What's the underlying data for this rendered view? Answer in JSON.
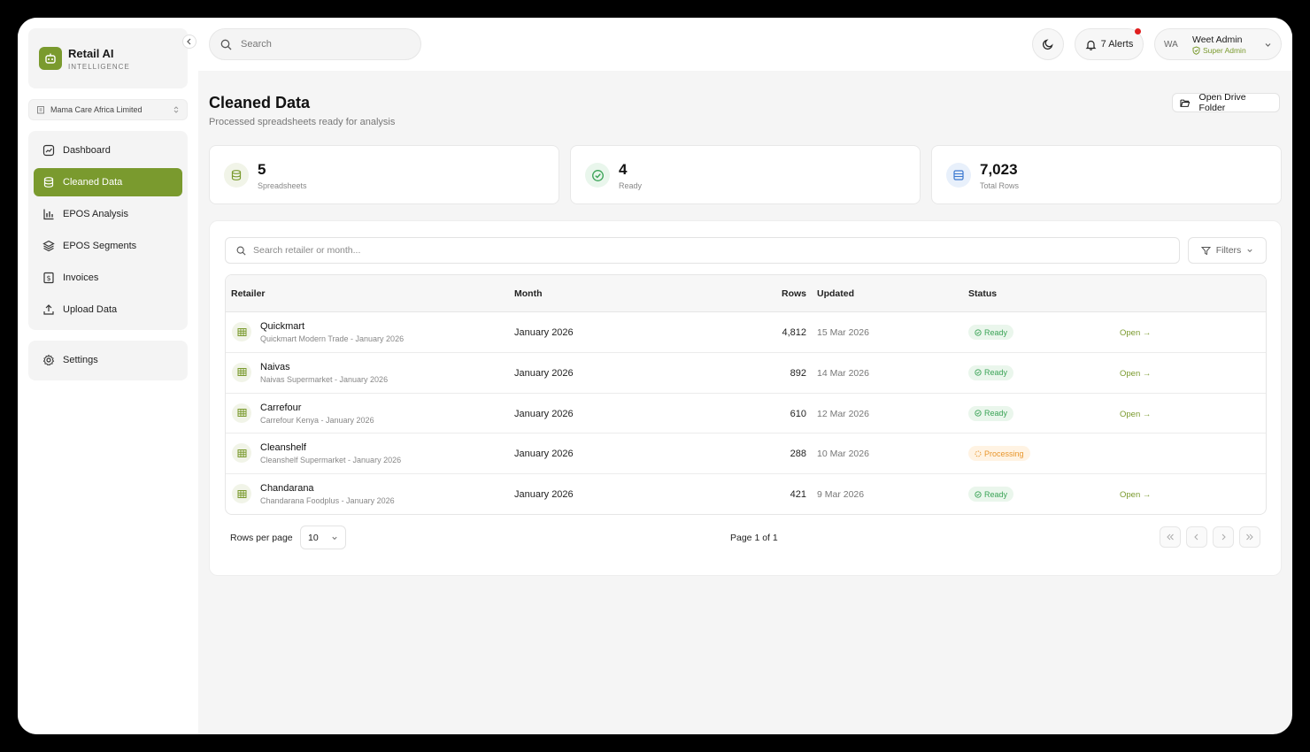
{
  "brand": {
    "title": "Retail AI",
    "subtitle": "INTELLIGENCE"
  },
  "org": {
    "label": "Mama Care Africa Limited"
  },
  "sidebar": {
    "items": [
      {
        "label": "Dashboard",
        "icon": "dashboard-icon"
      },
      {
        "label": "Cleaned Data",
        "icon": "database-icon",
        "active": true
      },
      {
        "label": "EPOS Analysis",
        "icon": "bar-chart-icon"
      },
      {
        "label": "EPOS Segments",
        "icon": "layers-icon"
      },
      {
        "label": "Invoices",
        "icon": "invoice-icon"
      },
      {
        "label": "Upload Data",
        "icon": "upload-icon"
      }
    ],
    "settings": {
      "label": "Settings",
      "icon": "gear-icon"
    }
  },
  "topbar": {
    "search_placeholder": "Search",
    "alerts_label": "7 Alerts",
    "user": {
      "initials": "WA",
      "name": "Weet Admin",
      "role": "Super Admin"
    }
  },
  "page": {
    "title": "Cleaned Data",
    "subtitle": "Processed spreadsheets ready for analysis",
    "drive_button": "Open Drive Folder"
  },
  "stats": [
    {
      "value": "5",
      "label": "Spreadsheets",
      "icon": "spreadsheet-icon"
    },
    {
      "value": "4",
      "label": "Ready",
      "icon": "check-circle-icon"
    },
    {
      "value": "7,023",
      "label": "Total Rows",
      "icon": "rows-icon"
    }
  ],
  "table": {
    "search_placeholder": "Search retailer or month...",
    "filters_label": "Filters",
    "columns": {
      "retailer": "Retailer",
      "month": "Month",
      "rows": "Rows",
      "updated": "Updated",
      "status": "Status"
    },
    "rows": [
      {
        "name": "Quickmart",
        "sub": "Quickmart Modern Trade - January 2026",
        "month": "January 2026",
        "rows": "4,812",
        "updated": "15 Mar 2026",
        "status": "Ready",
        "open": "Open →"
      },
      {
        "name": "Naivas",
        "sub": "Naivas Supermarket - January 2026",
        "month": "January 2026",
        "rows": "892",
        "updated": "14 Mar 2026",
        "status": "Ready",
        "open": "Open →"
      },
      {
        "name": "Carrefour",
        "sub": "Carrefour Kenya - January 2026",
        "month": "January 2026",
        "rows": "610",
        "updated": "12 Mar 2026",
        "status": "Ready",
        "open": "Open →"
      },
      {
        "name": "Cleanshelf",
        "sub": "Cleanshelf Supermarket - January 2026",
        "month": "January 2026",
        "rows": "288",
        "updated": "10 Mar 2026",
        "status": "Processing",
        "open": ""
      },
      {
        "name": "Chandarana",
        "sub": "Chandarana Foodplus - January 2026",
        "month": "January 2026",
        "rows": "421",
        "updated": "9 Mar 2026",
        "status": "Ready",
        "open": "Open →"
      }
    ]
  },
  "pagination": {
    "rows_per_page_label": "Rows per page",
    "rows_per_page": "10",
    "page_info": "Page 1 of 1"
  },
  "colors": {
    "accent": "#7a9a2e",
    "ready": "#3aa356",
    "processing": "#e8962c",
    "alert": "#e01e1e"
  }
}
